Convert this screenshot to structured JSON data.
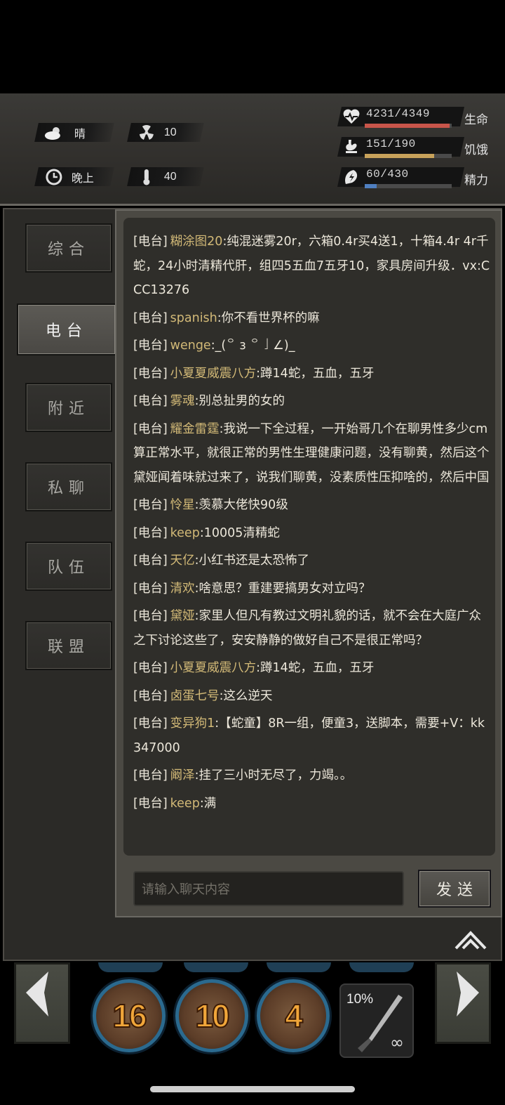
{
  "status": {
    "weather": {
      "icon": "cloud-sun-icon",
      "label": "晴"
    },
    "radiation": {
      "icon": "radiation-icon",
      "value": "10"
    },
    "time": {
      "icon": "clock-icon",
      "label": "晚上"
    },
    "temperature": {
      "icon": "thermometer-icon",
      "value": "40"
    }
  },
  "vitals": [
    {
      "name": "life",
      "icon": "heart-rate-icon",
      "value": "4231/4349",
      "label": "生命",
      "fraction": 0.973,
      "color": "#c8554a"
    },
    {
      "name": "hunger",
      "icon": "stomach-icon",
      "value": "151/190",
      "label": "饥饿",
      "fraction": 0.795,
      "color": "#c8a25a"
    },
    {
      "name": "energy",
      "icon": "energy-icon",
      "value": "60/430",
      "label": "精力",
      "fraction": 0.14,
      "color": "#4f7fc0"
    }
  ],
  "tabs": [
    {
      "id": "general",
      "label": "综合",
      "active": false
    },
    {
      "id": "radio",
      "label": "电台",
      "active": true
    },
    {
      "id": "nearby",
      "label": "附近",
      "active": false
    },
    {
      "id": "private",
      "label": "私聊",
      "active": false
    },
    {
      "id": "team",
      "label": "队伍",
      "active": false
    },
    {
      "id": "alliance",
      "label": "联盟",
      "active": false
    }
  ],
  "messages": [
    {
      "channel": "[电台]",
      "name": "糊涂图20",
      "text": ":纯混迷雾20r，六箱0.4r买4送1，十箱4.4r 4r千蛇，24小时清精代肝，组四5五血7五牙10，家具房间升级．vx:CCC13276"
    },
    {
      "channel": "[电台]",
      "name": "spanish",
      "text": ":你不看世界杯的嘛"
    },
    {
      "channel": "[电台]",
      "name": "wenge",
      "text": ":_(꒪ з ꒪ 」∠)_"
    },
    {
      "channel": "[电台]",
      "name": "小夏夏威震八方",
      "text": ":蹲14蛇，五血，五牙"
    },
    {
      "channel": "[电台]",
      "name": "雾魂",
      "text": ":别总扯男的女的"
    },
    {
      "channel": "[电台]",
      "name": "耀金雷霆",
      "text": ":我说一下全过程，一开始哥几个在聊男性多少cm算正常水平，就很正常的男性生理健康问题，没有聊黄，然后这个黛娅闻着味就过来了，说我们聊黄，没素质性压抑啥的，然后中国"
    },
    {
      "channel": "[电台]",
      "name": "怜星",
      "text": ":羡慕大佬快90级"
    },
    {
      "channel": "[电台]",
      "name": "keep",
      "text": ":10005清精蛇"
    },
    {
      "channel": "[电台]",
      "name": "天亿",
      "text": ":小红书还是太恐怖了"
    },
    {
      "channel": "[电台]",
      "name": "清欢",
      "text": ":啥意思？重建要搞男女对立吗？"
    },
    {
      "channel": "[电台]",
      "name": "黛娅",
      "text": ":家里人但凡有教过文明礼貌的话，就不会在大庭广众之下讨论这些了，安安静静的做好自己不是很正常吗？"
    },
    {
      "channel": "[电台]",
      "name": "小夏夏威震八方",
      "text": ":蹲14蛇，五血，五牙"
    },
    {
      "channel": "[电台]",
      "name": "卤蛋七号",
      "text": ":这么逆天"
    },
    {
      "channel": "[电台]",
      "name": "变异狗1",
      "text": ":【蛇童】8R一组，便童3，送脚本，需要+V：kk347000"
    },
    {
      "channel": "[电台]",
      "name": "阚泽",
      "text": ":挂了三小时无尽了，力竭。。"
    },
    {
      "channel": "[电台]",
      "name": "keep",
      "text": ":满"
    }
  ],
  "input": {
    "placeholder": "请输入聊天内容",
    "value": ""
  },
  "send_label": "发送",
  "skills": [
    {
      "name": "skill-slash",
      "count": "16"
    },
    {
      "name": "skill-smash",
      "count": "10"
    },
    {
      "name": "skill-dash",
      "count": "4"
    }
  ],
  "weapon": {
    "icon": "knife-icon",
    "durability": "10%",
    "uses": "∞"
  }
}
